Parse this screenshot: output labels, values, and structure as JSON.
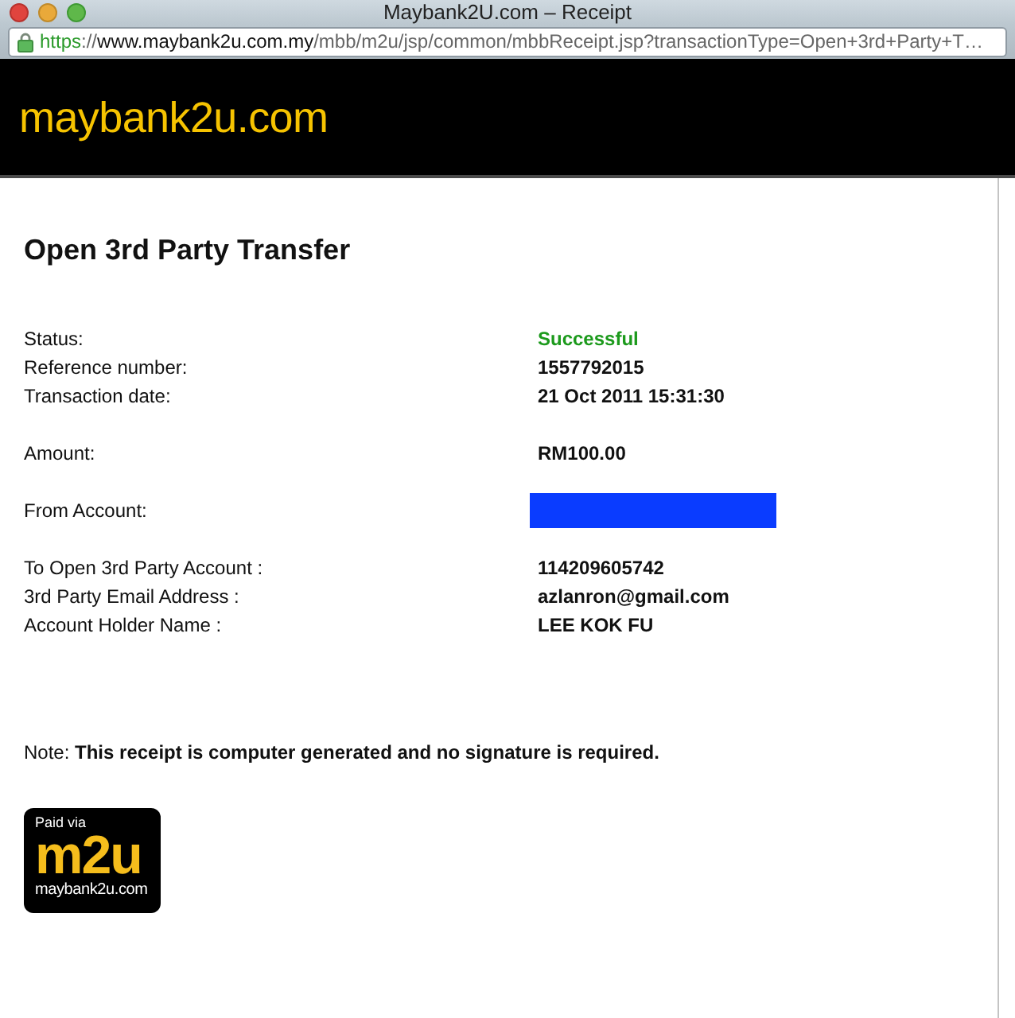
{
  "window": {
    "title": "Maybank2U.com – Receipt"
  },
  "address_bar": {
    "url": [
      {
        "text": "https",
        "kind": "scheme"
      },
      {
        "text": "://",
        "kind": "path"
      },
      {
        "text": "www.maybank2u.com.my",
        "kind": "host"
      },
      {
        "text": "/mbb/m2u/jsp/common/mbbReceipt.jsp?transactionType=Open+3rd+Party+T…",
        "kind": "path"
      }
    ]
  },
  "header": {
    "logo": "maybank2u.com"
  },
  "page_title": "Open 3rd Party Transfer",
  "detail_groups": [
    {
      "rows": [
        {
          "label": "Status:",
          "value": "Successful",
          "kind": "status"
        },
        {
          "label": "Reference number:",
          "value": "1557792015",
          "kind": "text"
        },
        {
          "label": "Transaction date:",
          "value": "21 Oct 2011 15:31:30",
          "kind": "text"
        }
      ]
    },
    {
      "rows": [
        {
          "label": "Amount:",
          "value": "RM100.00",
          "kind": "text"
        }
      ]
    },
    {
      "rows": [
        {
          "label": "From Account:",
          "kind": "redacted"
        }
      ]
    },
    {
      "rows": [
        {
          "label": "To Open 3rd Party Account :",
          "value": "114209605742",
          "kind": "text"
        },
        {
          "label": "3rd Party Email Address :",
          "value": "azlanron@gmail.com",
          "kind": "text"
        },
        {
          "label": "Account Holder Name :",
          "value": "LEE KOK FU",
          "kind": "text"
        }
      ]
    }
  ],
  "note": "Note: **This receipt is computer generated and no signature is required.**",
  "badge": {
    "caption": "Paid via",
    "logo": "m2u",
    "site": "maybank2u.com"
  }
}
